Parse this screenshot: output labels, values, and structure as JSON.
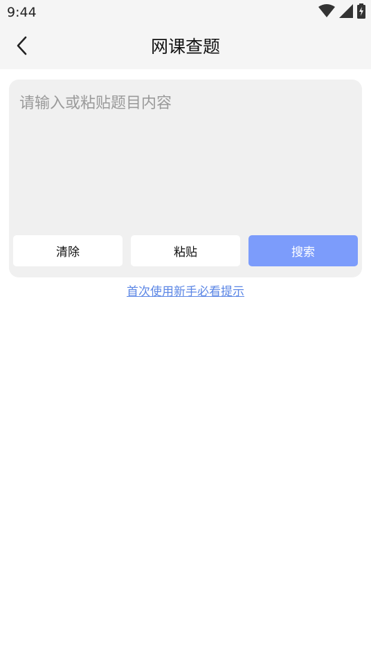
{
  "status_bar": {
    "time": "9:44",
    "icons": [
      "wifi-icon",
      "cell-signal-icon",
      "battery-charging-icon"
    ]
  },
  "header": {
    "title": "网课查题",
    "back_icon": "chevron-left-icon"
  },
  "question": {
    "value": "",
    "placeholder": "请输入或粘贴题目内容"
  },
  "actions": {
    "clear_label": "清除",
    "paste_label": "粘贴",
    "search_label": "搜索"
  },
  "hint": {
    "link_text": "首次使用新手必看提示"
  },
  "colors": {
    "accent": "#7c9cfb",
    "link": "#5b86e5",
    "card_bg": "#f0f0f0",
    "bar_bg": "#f5f5f5"
  }
}
